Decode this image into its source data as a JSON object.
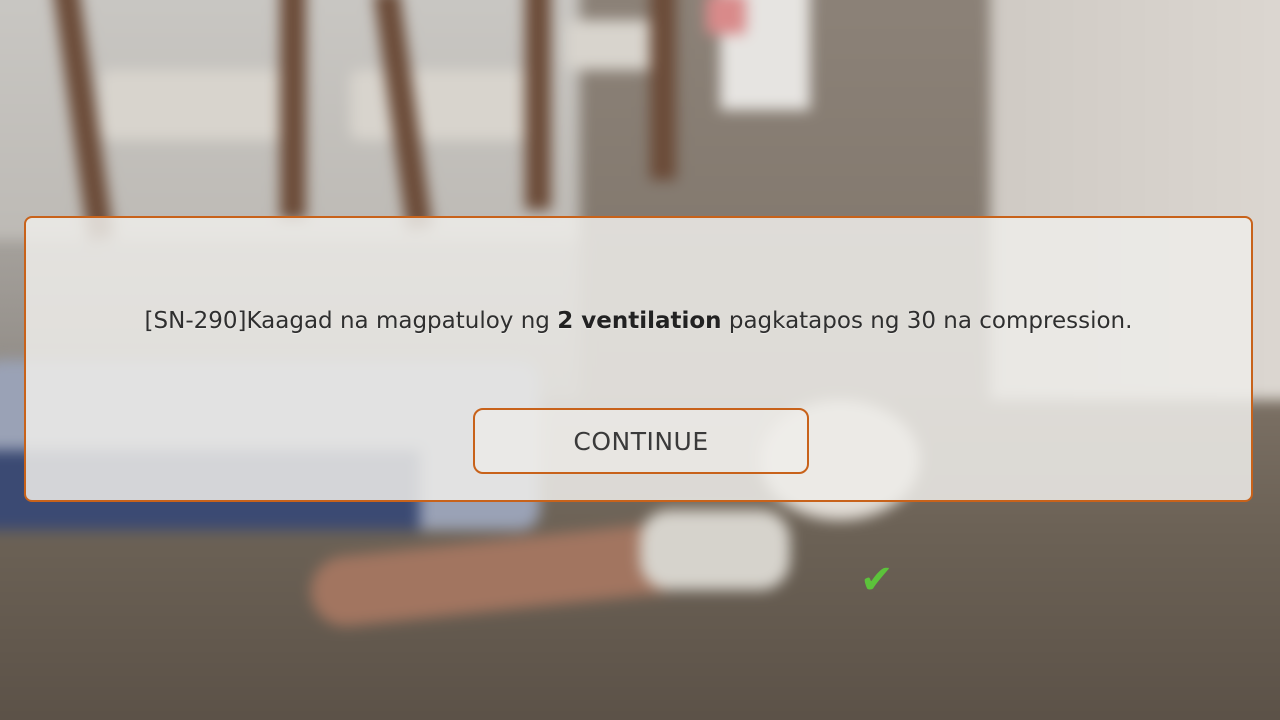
{
  "dialog": {
    "message_prefix": "[SN-290]Kaagad na magpatuloy ng ",
    "message_bold": "2 ventilation",
    "message_suffix": " pagkatapos ng 30 na compression.",
    "continue_label": "CONTINUE"
  },
  "colors": {
    "accent_border": "#c8621a",
    "dialog_bg": "#eeece9",
    "checkmark": "#5cc23b"
  },
  "icons": {
    "checkmark": "check-icon"
  }
}
